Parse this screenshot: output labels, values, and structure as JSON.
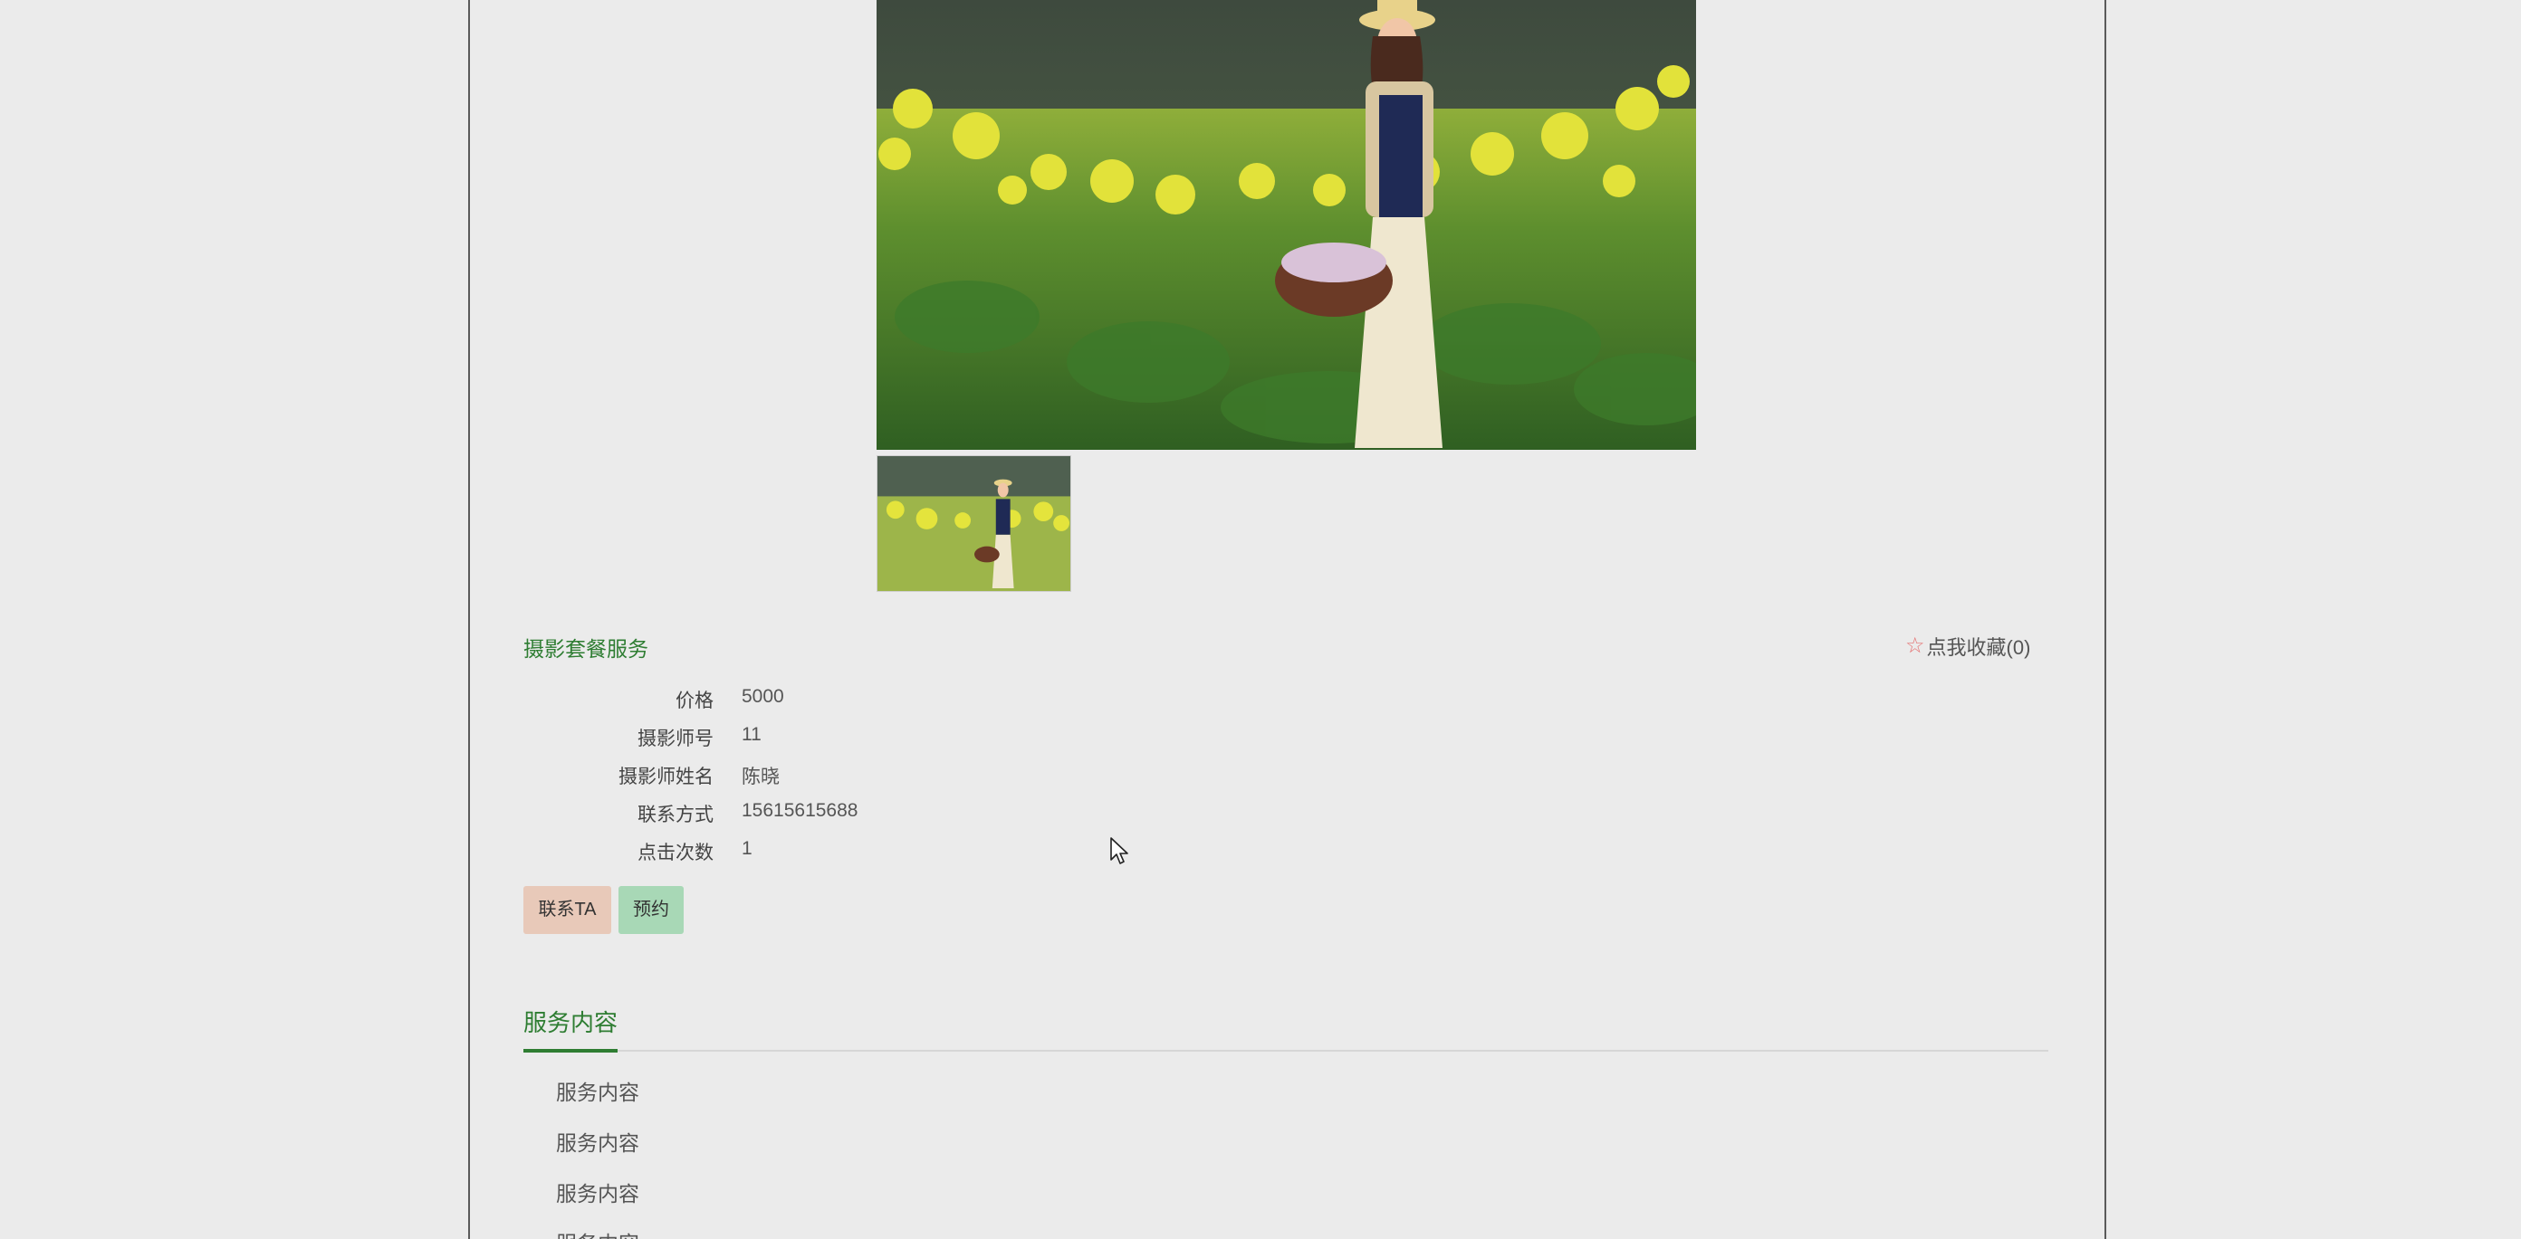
{
  "service": {
    "title": "摄影套餐服务",
    "favorite_label": "点我收藏(0)",
    "info": [
      {
        "label": "价格",
        "value": "5000"
      },
      {
        "label": "摄影师号",
        "value": "11"
      },
      {
        "label": "摄影师姓名",
        "value": "陈晓"
      },
      {
        "label": "联系方式",
        "value": "15615615688"
      },
      {
        "label": "点击次数",
        "value": "1"
      }
    ],
    "buttons": {
      "contact": "联系TA",
      "book": "预约"
    }
  },
  "tabs": {
    "active": "服务内容"
  },
  "content_items": [
    "服务内容",
    "服务内容",
    "服务内容",
    "服务内容"
  ],
  "colors": {
    "accent": "#2e7d32",
    "contact_button": "#e8c9b9",
    "book_button": "#a8d8b6",
    "background": "#ebebeb"
  },
  "icons": {
    "favorite": "star-outline-icon"
  }
}
